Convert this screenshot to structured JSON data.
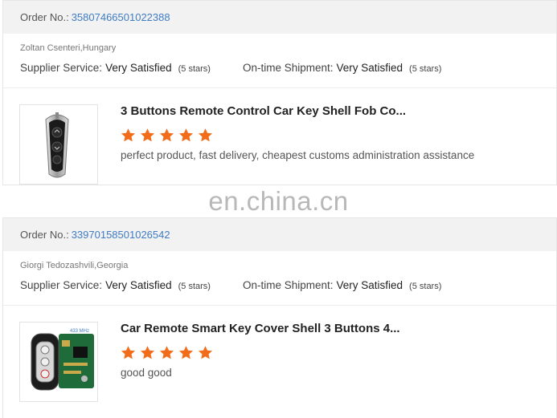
{
  "watermark": "en.china.cn",
  "reviews": [
    {
      "order_label": "Order No.:",
      "order_number": "35807466501022388",
      "reviewer": "Zoltan Csenteri,Hungary",
      "supplier_label": "Supplier Service:",
      "supplier_value": "Very Satisfied",
      "supplier_stars": "(5 stars)",
      "shipment_label": "On-time Shipment:",
      "shipment_value": "Very Satisfied",
      "shipment_stars": "(5 stars)",
      "product_title": "3 Buttons Remote Control Car Key Shell Fob Co...",
      "rating": 5,
      "comment": "perfect product, fast delivery, cheapest customs administration assistance"
    },
    {
      "order_label": "Order No.:",
      "order_number": "33970158501026542",
      "reviewer": "Giorgi Tedozashvili,Georgia",
      "supplier_label": "Supplier Service:",
      "supplier_value": "Very Satisfied",
      "supplier_stars": "(5 stars)",
      "shipment_label": "On-time Shipment:",
      "shipment_value": "Very Satisfied",
      "shipment_stars": "(5 stars)",
      "product_title": "Car Remote Smart Key Cover Shell 3 Buttons 4...",
      "rating": 5,
      "comment": "good good",
      "image_text": "433 MHz"
    }
  ],
  "colors": {
    "star": "#f26c1a",
    "link": "#3f7cc4",
    "bar": "#f2f2f2"
  }
}
